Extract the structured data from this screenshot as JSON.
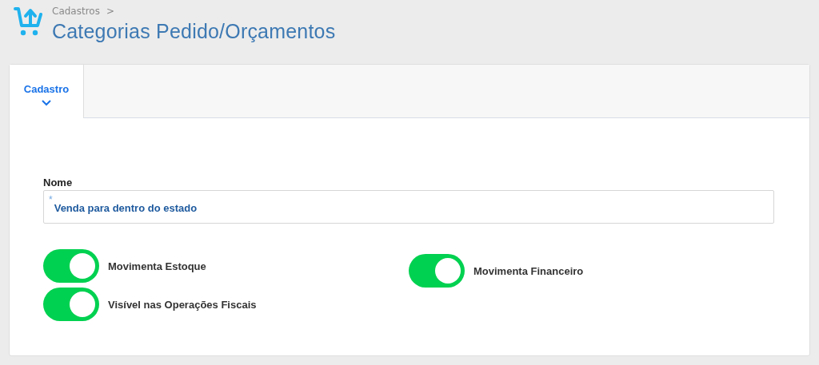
{
  "breadcrumb": {
    "label": "Cadastros",
    "separator": ">"
  },
  "page_title": "Categorias Pedido/Orçamentos",
  "tabs": [
    {
      "label": "Cadastro",
      "selected": true
    }
  ],
  "form": {
    "name_field": {
      "label": "Nome",
      "required_mark": "*",
      "value": "Venda para dentro do estado"
    },
    "toggle_columns": [
      [
        {
          "label": "Movimenta Estoque",
          "on": true
        },
        {
          "label": "Visível nas Operações Fiscais",
          "on": true
        }
      ],
      [
        {
          "label": "Movimenta Financeiro",
          "on": true
        }
      ]
    ]
  }
}
